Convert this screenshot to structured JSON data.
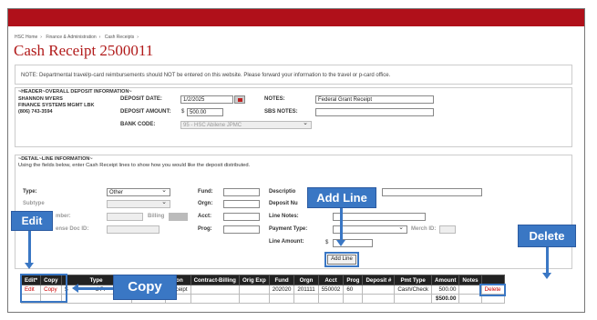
{
  "breadcrumb": [
    "HSC Home",
    "Finance & Administration",
    "Cash Receipts"
  ],
  "page_title": "Cash Receipt 2500011",
  "notice": "NOTE: Departmental travel/p-card reimbursements should NOT be entered on this website. Please forward your information to the travel or p-card office.",
  "header": {
    "section_title": "~HEADER~OVERALL DEPOSIT INFORMATION~",
    "contact_name": "SHANNON MYERS",
    "contact_dept": "FINANCE SYSTEMS MGMT LBK",
    "contact_phone": "(806) 743-3594",
    "deposit_date_label": "DEPOSIT DATE:",
    "deposit_date": "1/2/2025",
    "deposit_amount_label": "DEPOSIT AMOUNT:",
    "currency": "$",
    "deposit_amount": "500.00",
    "bank_code_label": "BANK CODE:",
    "bank_code": "95 - HSC Abilene JPMC",
    "notes_label": "NOTES:",
    "notes": "Federal Grant Receipt",
    "sbs_notes_label": "SBS NOTES:",
    "sbs_notes": ""
  },
  "detail": {
    "section_title": "~DETAIL~LINE INFORMATION~",
    "instructions": "Using the fields below, enter Cash Receipt lines to show how you would like the deposit distributed.",
    "type_label": "Type:",
    "type_value": "Other",
    "subtype_label": "Subtype",
    "number_label": "mber:",
    "billing_label": "Billing",
    "expense_doc_label": "ense Doc ID:",
    "fund_label": "Fund:",
    "orgn_label": "Orgn:",
    "acct_label": "Acct:",
    "prog_label": "Prog:",
    "description_label": "Descriptio",
    "deposit_num_label": "Deposit Nu",
    "line_notes_label": "Line Notes:",
    "payment_type_label": "Payment Type:",
    "merch_id_label": "Merch ID:",
    "line_amount_label": "Line Amount:",
    "currency": "$",
    "add_line_button": "Add Line"
  },
  "callouts": {
    "add_line": "Add Line",
    "edit": "Edit",
    "copy": "Copy",
    "delete": "Delete"
  },
  "table": {
    "headers": [
      "Edit*",
      "Copy",
      "Type",
      "",
      "tion",
      "Contract-Billing",
      "Orig Exp",
      "Fund",
      "Orgn",
      "Acct",
      "Prog",
      "Deposit #",
      "Pmt Type",
      "Amount",
      "Notes",
      ""
    ],
    "row": {
      "edit": "Edit",
      "copy": "Copy",
      "type": "S",
      "type_tail": "d Pr",
      "description": "Receipt",
      "contract_billing": "",
      "orig_exp": "",
      "fund": "202020",
      "orgn": "201111",
      "acct": "550002",
      "prog": "60",
      "deposit": "",
      "pmt_type": "Cash/Check",
      "amount": "500.00",
      "notes": "",
      "delete": "Delete"
    },
    "total": "$500.00"
  },
  "colors": {
    "brand_red": "#b0101a",
    "callout_blue": "#3a77c4"
  }
}
